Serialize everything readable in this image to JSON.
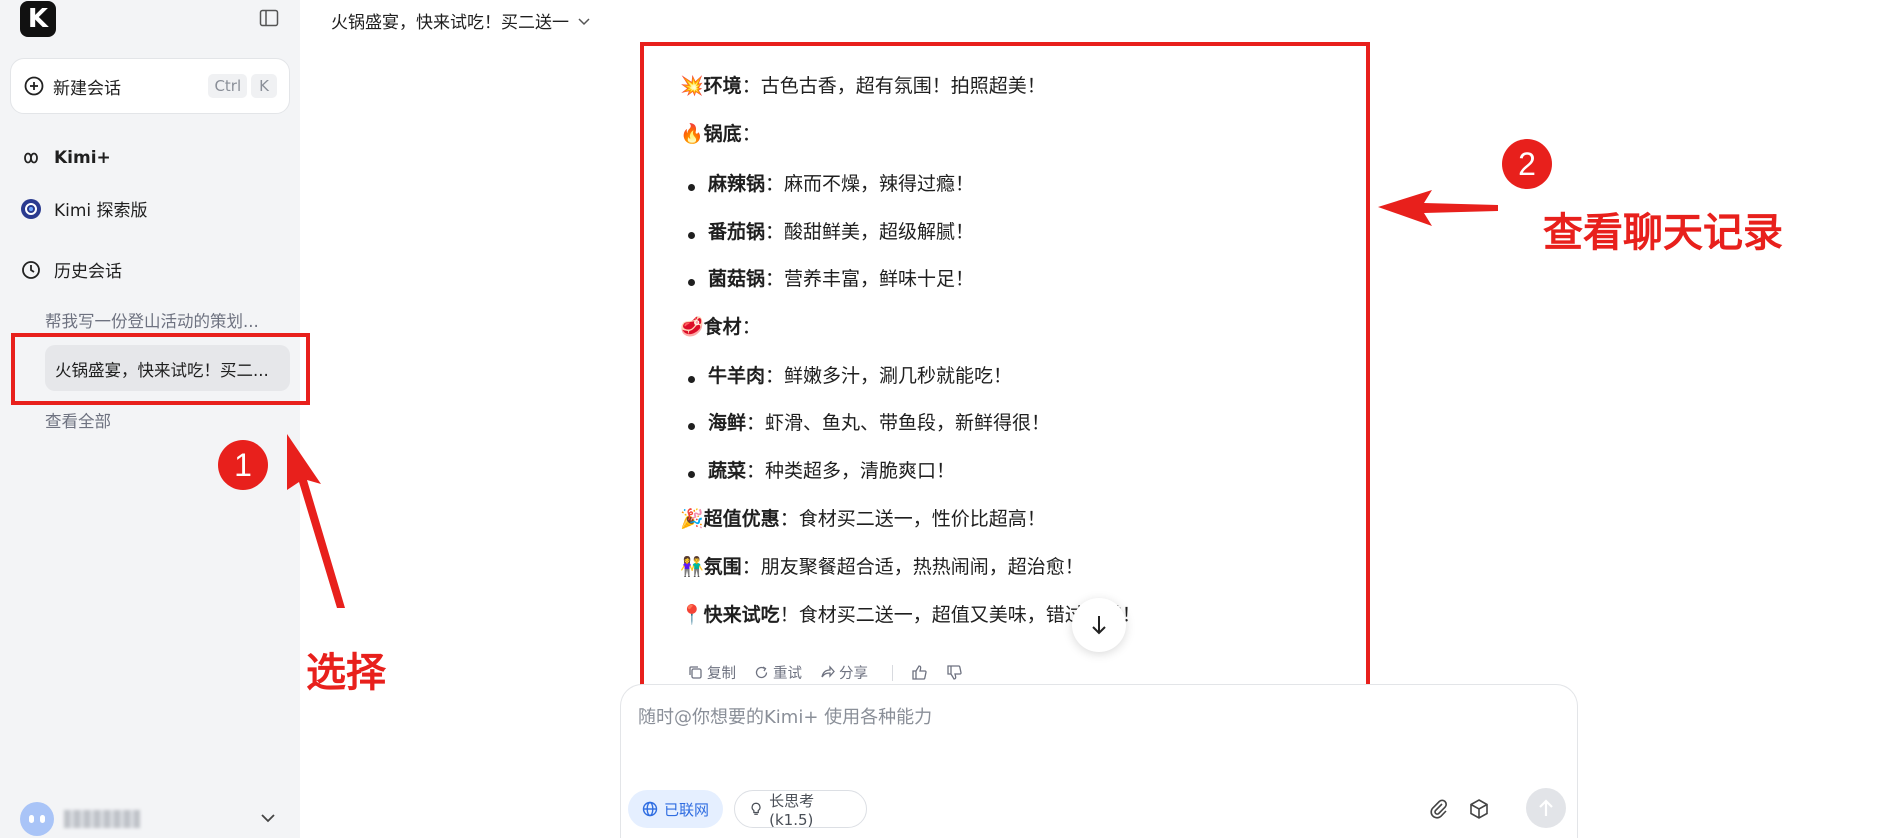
{
  "sidebar": {
    "logo": "K",
    "new_chat": {
      "label": "新建会话",
      "key1": "Ctrl",
      "key2": "K"
    },
    "nav": [
      {
        "label": "Kimi+"
      },
      {
        "label": "Kimi 探索版"
      },
      {
        "label": "历史会话"
      }
    ],
    "history": [
      {
        "label": "帮我写一份登山活动的策划..."
      },
      {
        "label": "火锅盛宴，快来试吃！买二..."
      }
    ],
    "view_all": "查看全部"
  },
  "header": {
    "title": "火锅盛宴，快来试吃！买二送一"
  },
  "message": {
    "lines": [
      {
        "icon": "💥",
        "strong": "环境",
        "rest": "：古色古香，超有氛围！拍照超美！"
      },
      {
        "icon": "🔥",
        "strong": "锅底",
        "rest": "："
      },
      {
        "bullet": true,
        "strong": "麻辣锅",
        "rest": "：麻而不燥，辣得过瘾！"
      },
      {
        "bullet": true,
        "strong": "番茄锅",
        "rest": "：酸甜鲜美，超级解腻！"
      },
      {
        "bullet": true,
        "strong": "菌菇锅",
        "rest": "：营养丰富，鲜味十足！"
      },
      {
        "icon": "🥩",
        "strong": "食材",
        "rest": "："
      },
      {
        "bullet": true,
        "strong": "牛羊肉",
        "rest": "：鲜嫩多汁，涮几秒就能吃！"
      },
      {
        "bullet": true,
        "strong": "海鲜",
        "rest": "：虾滑、鱼丸、带鱼段，新鲜得很！"
      },
      {
        "bullet": true,
        "strong": "蔬菜",
        "rest": "：种类超多，清脆爽口！"
      },
      {
        "icon": "🎉",
        "strong": "超值优惠",
        "rest": "：食材买二送一，性价比超高！"
      },
      {
        "icon": "👫",
        "strong": "氛围",
        "rest": "：朋友聚餐超合适，热热闹闹，超治愈！"
      },
      {
        "icon": "📍",
        "strong": "快来试吃",
        "rest": "！食材买二送一，超值又美味，错过可惜！"
      }
    ],
    "actions": {
      "copy": "复制",
      "retry": "重试",
      "share": "分享"
    }
  },
  "input": {
    "placeholder": "随时@你想要的Kimi+ 使用各种能力",
    "web_chip": "已联网",
    "think_chip": "长思考 (k1.5)"
  },
  "annotations": {
    "badge1": "1",
    "badge2": "2",
    "label1": "选择",
    "label2": "查看聊天记录"
  },
  "colors": {
    "annotation": "#e8201c",
    "accent": "#2f6de1"
  }
}
